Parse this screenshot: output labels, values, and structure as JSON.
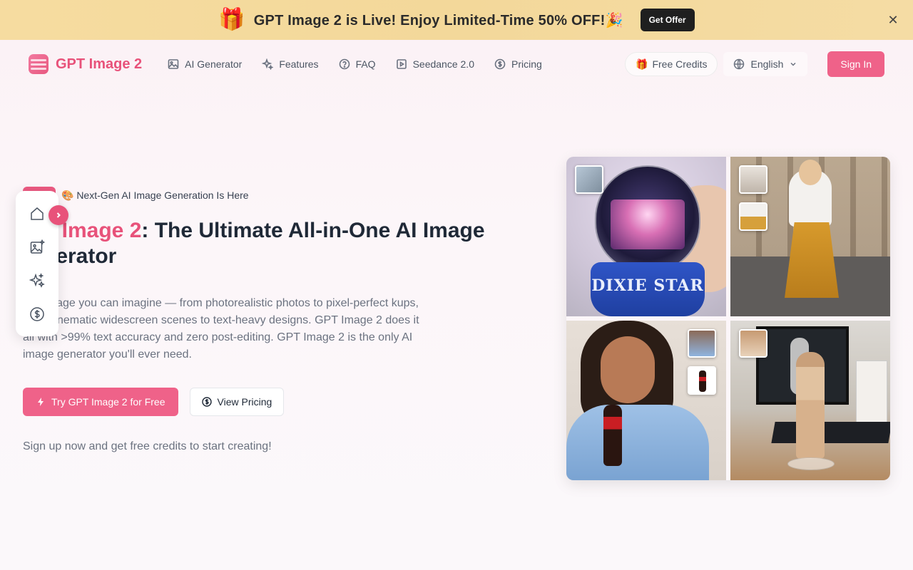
{
  "promo": {
    "text": "GPT Image 2 is Live! Enjoy Limited-Time 50% OFF!🎉",
    "button": "Get Offer",
    "gift_icon": "gift-icon",
    "close_icon": "close-icon"
  },
  "header": {
    "brand": "GPT Image 2",
    "nav": [
      {
        "label": "AI Generator",
        "icon": "image-icon"
      },
      {
        "label": "Features",
        "icon": "sparkles-icon"
      },
      {
        "label": "FAQ",
        "icon": "help-circle-icon"
      },
      {
        "label": "Seedance 2.0",
        "icon": "video-icon"
      },
      {
        "label": "Pricing",
        "icon": "dollar-circle-icon"
      }
    ],
    "free_credits": "Free Credits",
    "language": "English",
    "sign_in": "Sign In"
  },
  "hero": {
    "badge": "🎨 Next-Gen AI Image Generation Is Here",
    "title_accent": "T Image 2",
    "title_rest": ": The Ultimate All-in-One AI Image",
    "title_line2": "nerator",
    "description": "any image you can imagine — from photorealistic photos to pixel-perfect kups, from cinematic widescreen scenes to text-heavy designs. GPT Image 2 does it all with >99% text accuracy and zero post-editing. GPT Image 2 is the only AI image generator you'll ever need.",
    "cta_primary": "Try GPT Image 2 for Free",
    "cta_secondary": "View Pricing",
    "signup_note": "Sign up now and get free credits to start creating!"
  },
  "float_bar": {
    "icons": [
      "home-icon",
      "image-sparkle-icon",
      "sparkles-icon",
      "dollar-circle-icon"
    ],
    "toggle_icon": "chevron-right-icon"
  },
  "gallery": {
    "tile1_label": "DIXIE STAR"
  },
  "colors": {
    "accent": "#e8527a",
    "button": "#ef6289",
    "promo_bg": "#f5dca0"
  }
}
